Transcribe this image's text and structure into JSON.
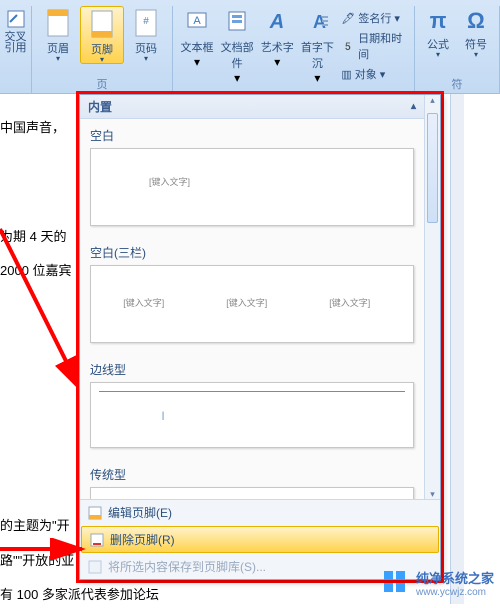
{
  "ribbon": {
    "groups": {
      "hf": {
        "cross_ref": "交叉\n引用",
        "header": "页眉",
        "footer": "页脚",
        "page_number": "页码",
        "label": "页"
      },
      "text": {
        "textbox": "文本框",
        "parts": "文档部件",
        "wordart": "艺术字",
        "dropcap": "首字下沉",
        "signature": "签名行",
        "datetime": "日期和时间",
        "object": "对象"
      },
      "symbols": {
        "equation": "公式",
        "symbol": "符号",
        "label": "符"
      }
    }
  },
  "document": {
    "frag1": "中国声音，",
    "frag2": "为期 4 天的",
    "frag3": "2000 位嘉宾",
    "frag4": "的主题为\"开",
    "frag5": "路\"\"开放的亚",
    "frag6": "有 100 多家派代表参加论坛"
  },
  "panel": {
    "builtin_title": "内置",
    "items": {
      "blank": "空白",
      "blank3": "空白(三栏)",
      "edge": "边线型",
      "classic": "传统型"
    },
    "placeholder": "[键入文字]",
    "footer_cmds": {
      "edit": "编辑页脚(E)",
      "remove": "删除页脚(R)",
      "save": "将所选内容保存到页脚库(S)..."
    }
  },
  "watermark": {
    "site": "纯净系统之家",
    "url": "www.ycwjz.com"
  }
}
